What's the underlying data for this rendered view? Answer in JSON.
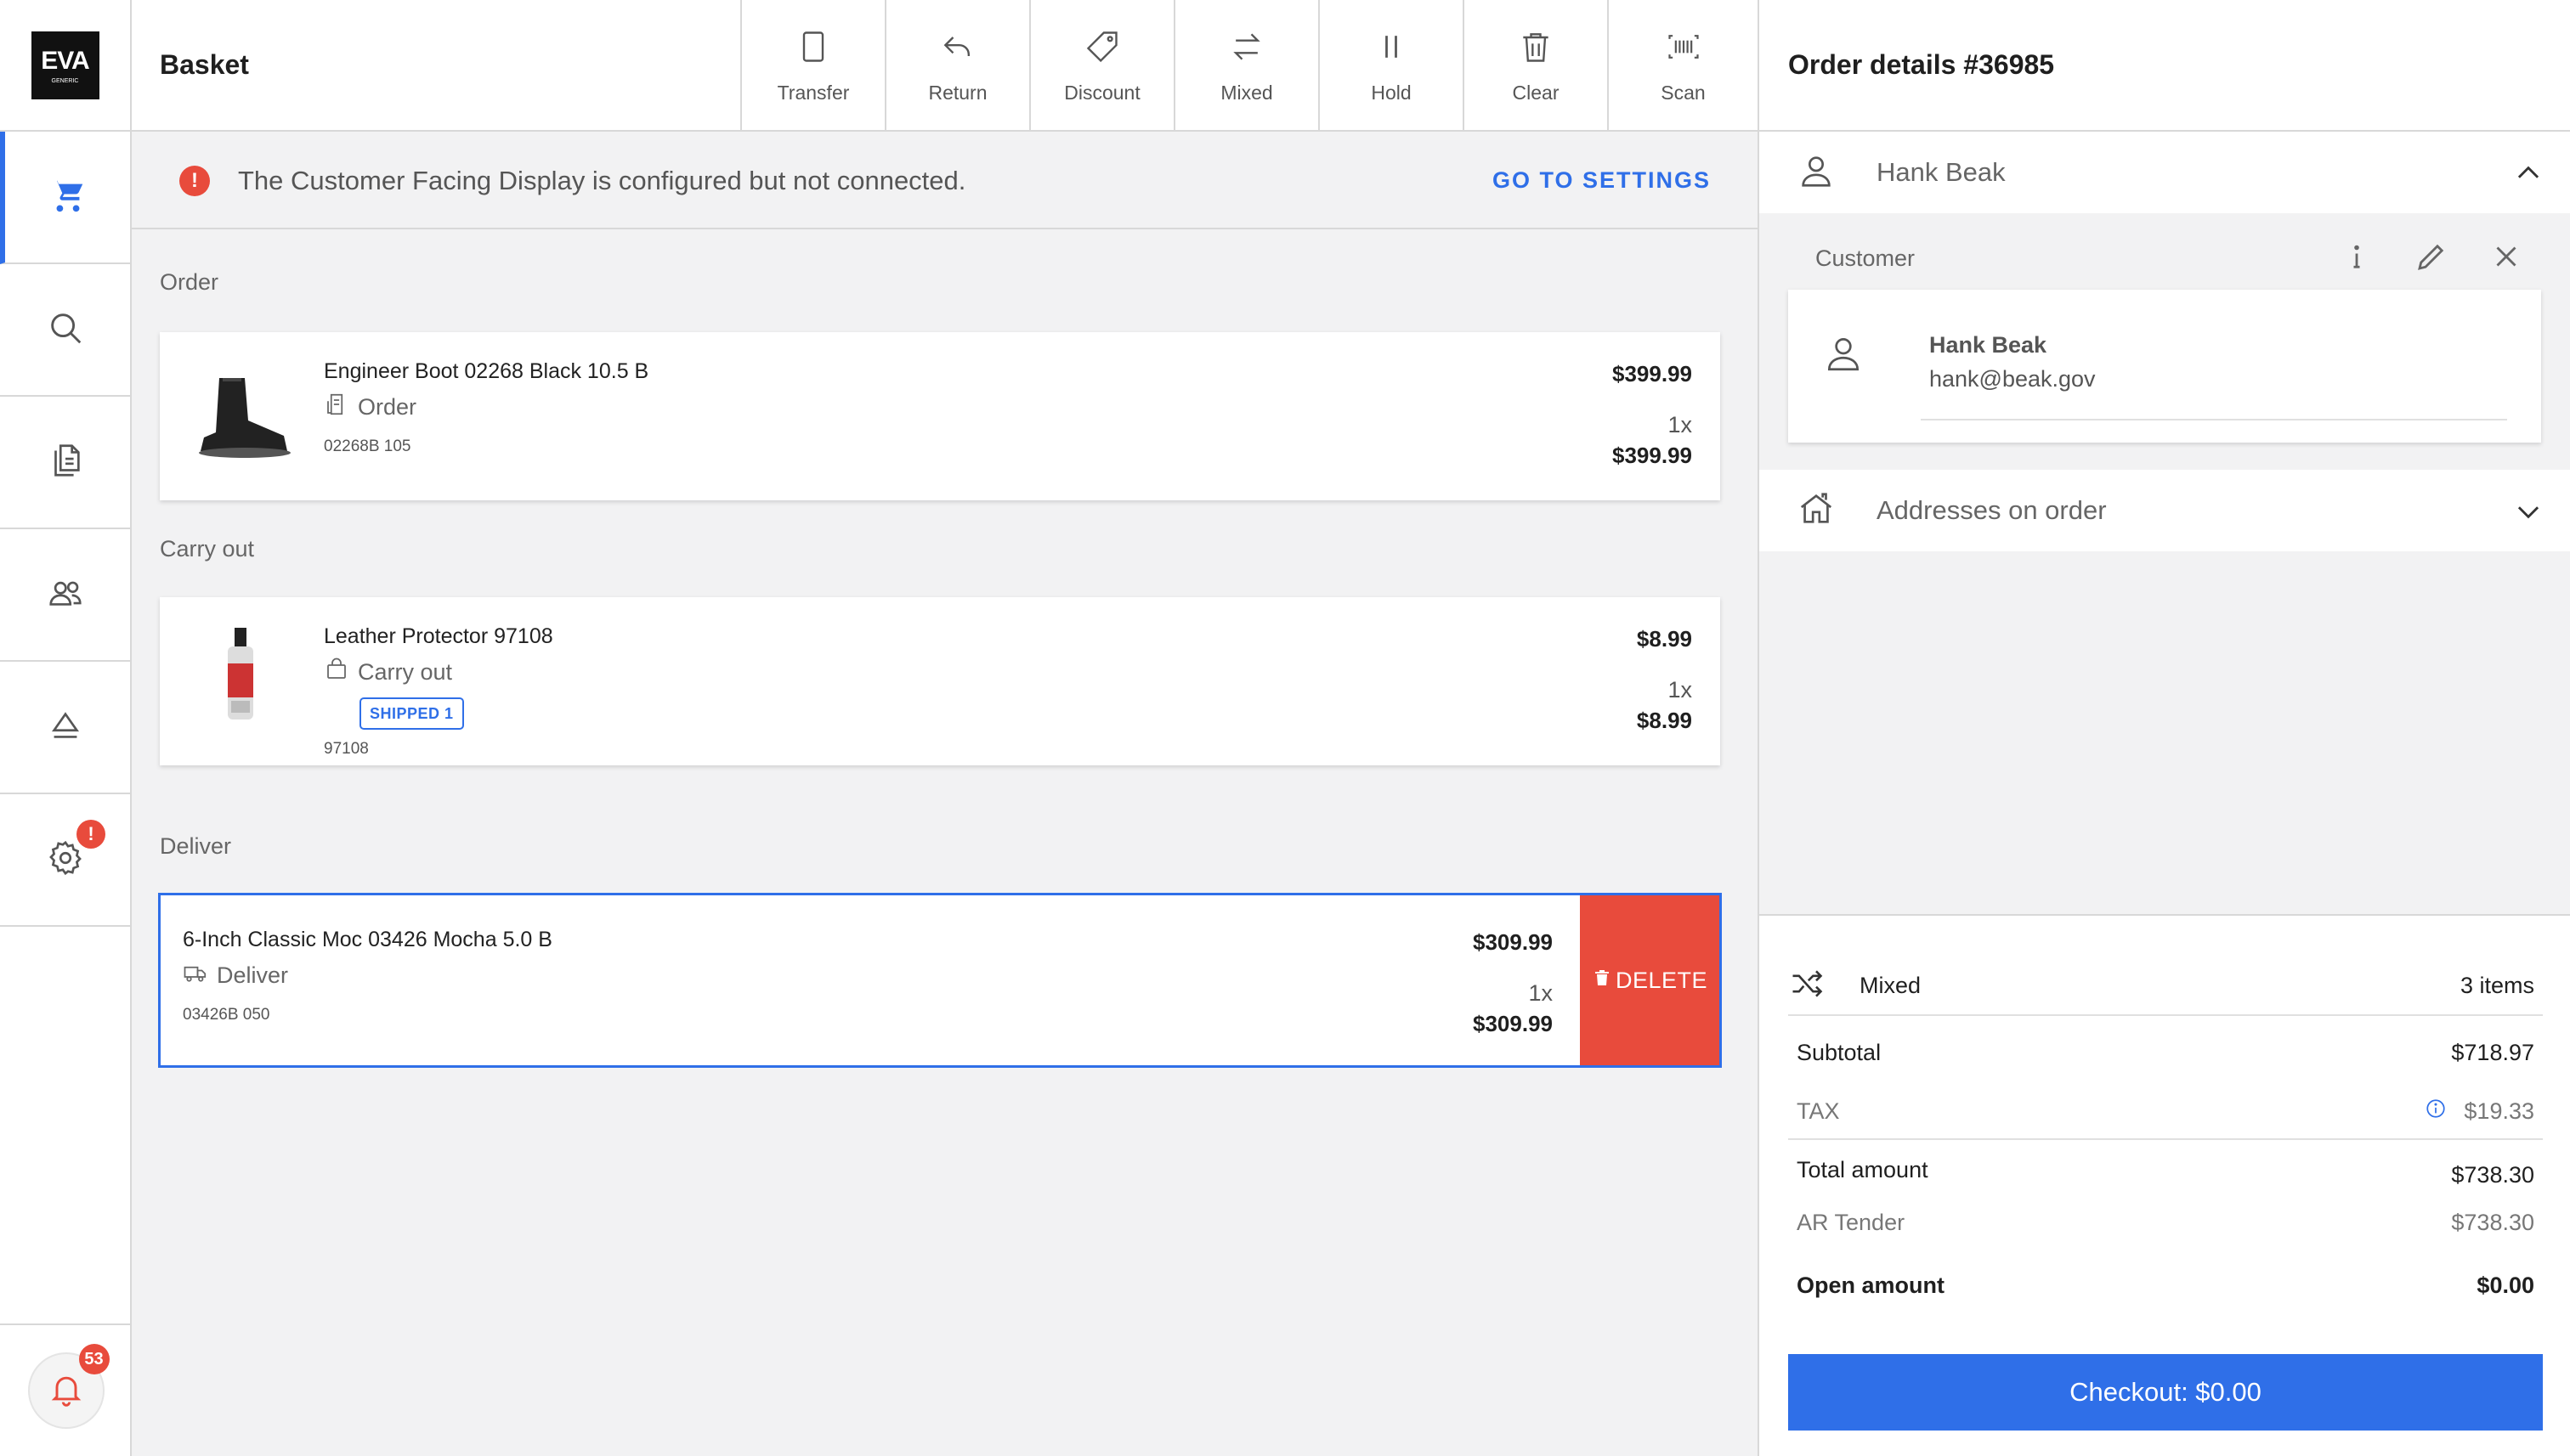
{
  "app": {
    "logo_text": "EVA",
    "logo_sub": "GENERIC"
  },
  "topbar": {
    "title": "Basket",
    "tools": [
      {
        "label": "Transfer",
        "icon": "tablet-icon"
      },
      {
        "label": "Return",
        "icon": "return-icon"
      },
      {
        "label": "Discount",
        "icon": "tag-icon"
      },
      {
        "label": "Mixed",
        "icon": "swap-icon"
      },
      {
        "label": "Hold",
        "icon": "pause-icon"
      },
      {
        "label": "Clear",
        "icon": "trash-icon"
      },
      {
        "label": "Scan",
        "icon": "barcode-icon"
      }
    ]
  },
  "sidebar": {
    "items": [
      {
        "name": "cart",
        "icon": "cart-icon",
        "active": true
      },
      {
        "name": "search",
        "icon": "search-icon"
      },
      {
        "name": "documents",
        "icon": "documents-icon"
      },
      {
        "name": "customers",
        "icon": "users-icon"
      },
      {
        "name": "eject",
        "icon": "eject-icon"
      },
      {
        "name": "settings",
        "icon": "gear-icon",
        "badge": "!"
      }
    ],
    "notifications": {
      "icon": "bell-icon",
      "count": "53"
    }
  },
  "alert": {
    "icon_text": "!",
    "message": "The Customer Facing Display is configured but not connected.",
    "link": "GO TO SETTINGS"
  },
  "sections": {
    "order_label": "Order",
    "carryout_label": "Carry out",
    "deliver_label": "Deliver"
  },
  "lines": [
    {
      "name": "Engineer Boot 02268 Black 10.5 B",
      "method": "Order",
      "method_icon": "document-icon",
      "sku": "02268B 105",
      "price": "$399.99",
      "qty": "1x",
      "total": "$399.99"
    },
    {
      "name": "Leather Protector 97108",
      "method": "Carry out",
      "method_icon": "bag-icon",
      "badge": "SHIPPED 1",
      "sku": "97108",
      "price": "$8.99",
      "qty": "1x",
      "total": "$8.99"
    },
    {
      "name": "6-Inch Classic Moc 03426 Mocha 5.0 B",
      "method": "Deliver",
      "method_icon": "truck-icon",
      "sku": "03426B 050",
      "price": "$309.99",
      "qty": "1x",
      "total": "$309.99",
      "action": "DELETE"
    }
  ],
  "order_details": {
    "title": "Order details #36985",
    "customer_header": "Hank Beak",
    "customer_label": "Customer",
    "customer_name": "Hank Beak",
    "customer_email": "hank@beak.gov",
    "addresses_label": "Addresses on order"
  },
  "totals": {
    "mixed_label": "Mixed",
    "items_count": "3 items",
    "subtotal_label": "Subtotal",
    "subtotal": "$718.97",
    "tax_label": "TAX",
    "tax": "$19.33",
    "total_label": "Total amount",
    "total": "$738.30",
    "tender_label": "AR Tender",
    "tender": "$738.30",
    "open_label": "Open amount",
    "open": "$0.00",
    "checkout": "Checkout: $0.00"
  },
  "colors": {
    "accent": "#2f6fe8",
    "danger": "#e84b3c",
    "background": "#f2f2f3"
  }
}
